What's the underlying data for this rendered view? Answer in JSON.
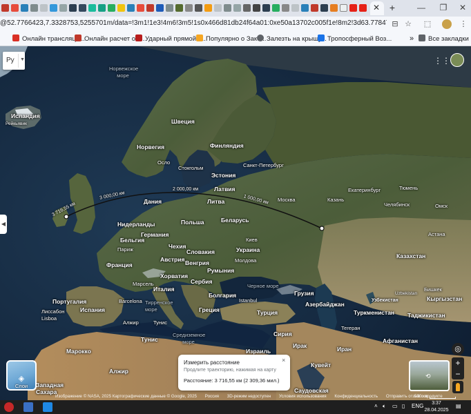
{
  "browser": {
    "url": "@52.7766423,7.3328753,5255701m/data=!3m1!1e3!4m6!3m5!1s0x466d81db24f64a01:0xe50a13702c005f1e!8m2!3d63.778478214d11.5787958!16zL20vMDU",
    "bookmarks": [
      "Онлайн трансляци...",
      "Онлайн расчет об...",
      "Ударный прямой т...",
      "Популярно о Зако...",
      "Залезть на крышу...",
      "Тропосферный Воз..."
    ],
    "all_bookmarks": "Все закладки",
    "more_bookmarks": "»"
  },
  "map": {
    "language_button": "Ру",
    "layers_label": "Слои",
    "labels": {
      "norwegian_sea": "Норвежское море",
      "iceland": "Исландия",
      "reykjavik": "Рейкьявик",
      "sweden": "Швеция",
      "norway": "Норвегия",
      "finland": "Финляндия",
      "oslo": "Осло",
      "stockholm": "Стокгольм",
      "st_petersburg": "Санкт-Петербург",
      "estonia": "Эстония",
      "latvia": "Латвия",
      "denmark": "Дания",
      "lithuania": "Литва",
      "moscow": "Москва",
      "belarus": "Беларусь",
      "netherlands": "Нидерланды",
      "poland": "Польша",
      "germany": "Германия",
      "belgium": "Бельгия",
      "kyiv": "Киев",
      "paris": "Париж",
      "czechia": "Чехия",
      "slovakia": "Словакия",
      "ukraine": "Украина",
      "france": "Франция",
      "austria": "Австрия",
      "hungary": "Венгрия",
      "moldova": "Молдова",
      "romania": "Румыния",
      "croatia": "Хорватия",
      "serbia": "Сербия",
      "marseille": "Марсель",
      "italy": "Италия",
      "black_sea": "Черное море",
      "bulgaria": "Болгария",
      "portugal": "Португалия",
      "barcelona": "Barcelona",
      "tyrrhenian": "Тирренское море",
      "istanbul": "Istanbul",
      "georgia": "Грузия",
      "azerbaijan": "Азербайджан",
      "turkey": "Турция",
      "lisbon": "Лиссабон Lisboa",
      "spain": "Испания",
      "greece": "Греция",
      "algiers": "Алжир",
      "tunis_city": "Тунис",
      "mediterranean": "Средиземное море",
      "tunisia": "Тунис",
      "syria": "Сирия",
      "iraq": "Ирак",
      "iran": "Иран",
      "tehran": "Тегеран",
      "morocco": "Марокко",
      "algeria": "Алжир",
      "israel": "Израиль",
      "kuwait": "Кувейт",
      "west_sahara": "Западная Сахара",
      "saudi": "Саудовская",
      "ekaterinburg": "Екатеринбург",
      "tyumen": "Тюмень",
      "kazan": "Казань",
      "chelyabinsk": "Челябинск",
      "omsk": "Омск",
      "astana": "Астана",
      "kazakhstan": "Казахстан",
      "uzbekistan": "Uzbekistan",
      "bishkek": "Бишкек",
      "kyrgyzstan": "Кыргызстан",
      "turkmenistan": "Туркменистан",
      "tajikistan": "Таджикистан",
      "afghanistan": "Афганистан",
      "uzbekistan_ru": "Узбекистан"
    },
    "distance_labels": [
      "3 716,55 км",
      "3 000,00 км",
      "2 000,00 км",
      "1 000,00 км"
    ],
    "popup": {
      "title": "Измерить расстояние",
      "hint": "Продлите траекторию, нажимая на карту",
      "distance": "Расстояние: 3 716,55 км (2 309,36 мил.)",
      "close": "×"
    },
    "footer": [
      "Изображение © NASA, 2025 Картографические данные © Google, 2025",
      "Россия",
      "3D-режим недоступен",
      "Условия использования",
      "Конфиденциальность",
      "Отправить отзыв о продукте"
    ],
    "scale": "500 км",
    "zoom_in": "+",
    "zoom_out": "−"
  },
  "taskbar": {
    "lang": "ENG",
    "time": "3:37",
    "date": "28.04.2025"
  }
}
